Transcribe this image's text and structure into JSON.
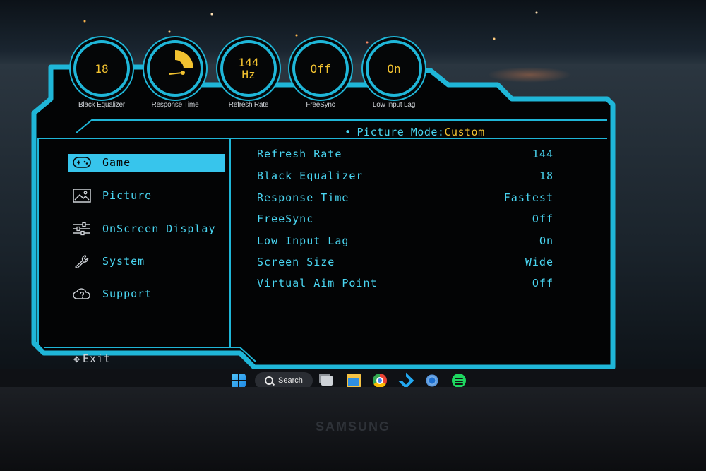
{
  "dials": [
    {
      "id": "black-equalizer",
      "value": "18",
      "label": "Black Equalizer"
    },
    {
      "id": "response-time",
      "value": "",
      "label": "Response Time"
    },
    {
      "id": "refresh-rate",
      "value": "144\nHz",
      "label": "Refresh Rate"
    },
    {
      "id": "freesync",
      "value": "Off",
      "label": "FreeSync"
    },
    {
      "id": "low-input-lag",
      "value": "On",
      "label": "Low Input Lag"
    }
  ],
  "picture_mode": {
    "label": "Picture Mode:",
    "value": "Custom"
  },
  "menu": [
    {
      "label": "Game",
      "icon": "gamepad-icon",
      "active": true
    },
    {
      "label": "Picture",
      "icon": "image-icon",
      "active": false
    },
    {
      "label": "OnScreen Display",
      "icon": "sliders-icon",
      "active": false
    },
    {
      "label": "System",
      "icon": "wrench-icon",
      "active": false
    },
    {
      "label": "Support",
      "icon": "help-cloud-icon",
      "active": false
    }
  ],
  "settings": [
    {
      "name": "Refresh Rate",
      "value": "144"
    },
    {
      "name": "Black Equalizer",
      "value": "18"
    },
    {
      "name": "Response Time",
      "value": "Fastest"
    },
    {
      "name": "FreeSync",
      "value": "Off"
    },
    {
      "name": "Low Input Lag",
      "value": "On"
    },
    {
      "name": "Screen Size",
      "value": "Wide"
    },
    {
      "name": "Virtual Aim Point",
      "value": "Off"
    }
  ],
  "exit_label": "Exit",
  "taskbar": {
    "search_label": "Search",
    "icons": [
      "windows-start-icon",
      "search-icon",
      "task-view-icon",
      "file-explorer-icon",
      "chrome-icon",
      "vscode-icon",
      "settings-gear-icon",
      "spotify-icon"
    ]
  },
  "brand": "SAMSUNG",
  "colors": {
    "accent": "#1fb6d8",
    "highlight": "#f2c230",
    "text": "#4ad6f2"
  }
}
